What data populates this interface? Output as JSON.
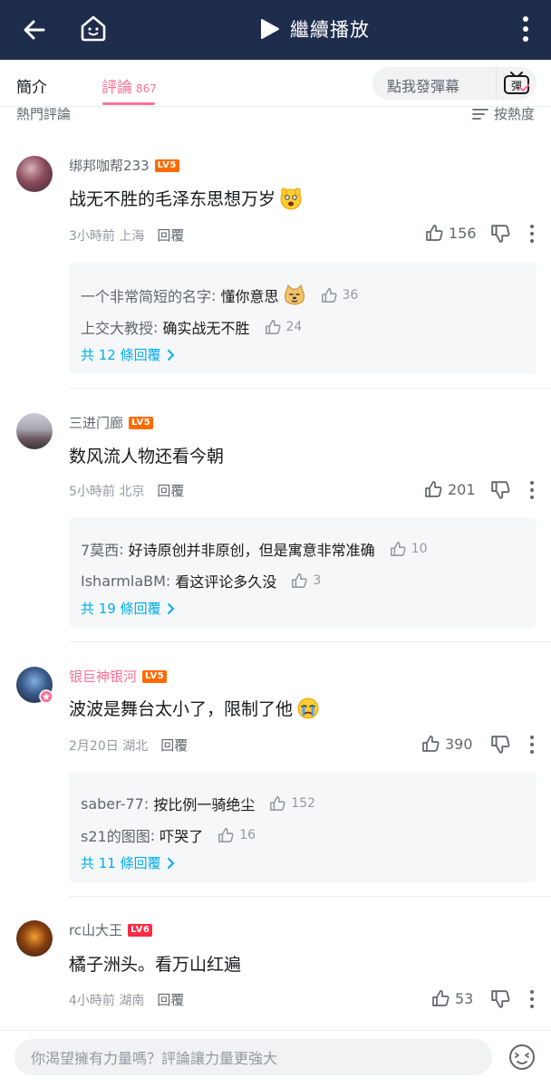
{
  "topbar": {
    "play_label": "繼續播放",
    "colors": {
      "background": "#1f2d4d",
      "text": "#ffffff"
    }
  },
  "tabs": {
    "intro": "簡介",
    "comments": "評論",
    "comment_count": "867",
    "danmaku_placeholder": "點我發彈幕",
    "danmaku_button": "彈"
  },
  "sort": {
    "hot_label": "熱門評論",
    "sort_label": "按熱度"
  },
  "comments": [
    {
      "user": "绑邦咖帮233",
      "level": "LV5",
      "text": "战无不胜的毛泽东思想万岁",
      "emoji": "scared-face-emoji",
      "time": "3小時前",
      "location": "上海",
      "reply_label": "回覆",
      "likes": "156",
      "replies": [
        {
          "name": "一个非常简短的名字",
          "text": "懂你意思",
          "emoji": "doge-emoji",
          "likes": "36"
        },
        {
          "name": "上交大教授",
          "text": "确实战无不胜",
          "likes": "24"
        }
      ],
      "more_replies": "共 12 條回覆"
    },
    {
      "user": "三进门廊",
      "level": "LV5",
      "text": "数风流人物还看今朝",
      "time": "5小時前",
      "location": "北京",
      "reply_label": "回覆",
      "likes": "201",
      "replies": [
        {
          "name": "7莫西",
          "text": "好诗原创并非原创，但是寓意非常准确",
          "likes": "10"
        },
        {
          "name": "IsharmlaBM",
          "text": "看这评论多久没",
          "likes": "3"
        }
      ],
      "more_replies": "共 19 條回覆"
    },
    {
      "user": "银巨神银河",
      "level": "LV5",
      "vip": true,
      "text": "波波是舞台太小了，限制了他",
      "emoji": "crying-face-emoji",
      "time": "2月20日",
      "location": "湖北",
      "reply_label": "回覆",
      "likes": "390",
      "replies": [
        {
          "name": "saber-77",
          "text": "按比例一骑绝尘",
          "likes": "152"
        },
        {
          "name": "s21的图图",
          "text": "吓哭了",
          "likes": "16"
        }
      ],
      "more_replies": "共 11 條回覆"
    },
    {
      "user": "rc山大王",
      "level": "LV6",
      "text": "橘子洲头。看万山红遍",
      "time": "4小時前",
      "location": "湖南",
      "reply_label": "回覆",
      "likes": "53"
    }
  ],
  "bottom": {
    "input_placeholder": "你渴望擁有力量嗎？評論讓力量更強大"
  },
  "colors": {
    "accent_pink": "#fb7299",
    "link_blue": "#00aeec",
    "level5": "#ff6a00",
    "level6": "#ff2a45"
  }
}
